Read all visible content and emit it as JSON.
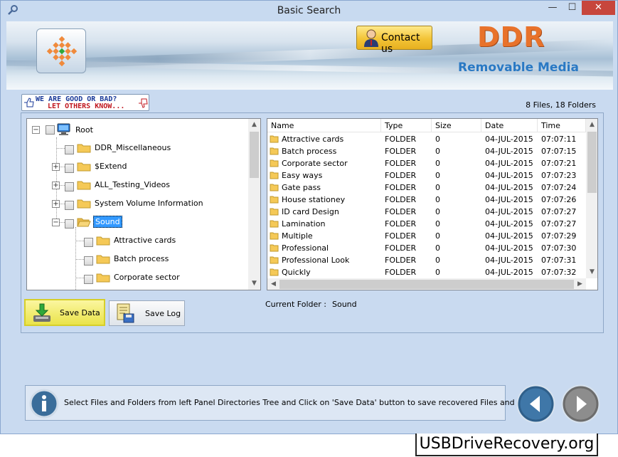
{
  "window": {
    "title": "Basic Search",
    "controls": {
      "minimize": "—",
      "maximize": "☐",
      "close": "✕"
    }
  },
  "banner": {
    "contact_label": "Contact us",
    "brand": "DDR",
    "brand_sub": "Removable Media"
  },
  "feedback": {
    "line1": "WE ARE GOOD OR BAD?",
    "line2": "LET OTHERS KNOW..."
  },
  "counts": "8 Files, 18 Folders",
  "tree": {
    "root": "Root",
    "items": [
      {
        "label": "DDR_Miscellaneous",
        "expander": "",
        "level": 1
      },
      {
        "label": "$Extend",
        "expander": "+",
        "level": 1
      },
      {
        "label": "ALL_Testing_Videos",
        "expander": "+",
        "level": 1
      },
      {
        "label": "System Volume Information",
        "expander": "+",
        "level": 1
      },
      {
        "label": "Sound",
        "expander": "−",
        "level": 1,
        "selected": true
      },
      {
        "label": "Attractive cards",
        "expander": "",
        "level": 2
      },
      {
        "label": "Batch process",
        "expander": "",
        "level": 2
      },
      {
        "label": "Corporate sector",
        "expander": "",
        "level": 2
      }
    ]
  },
  "list": {
    "columns": [
      "Name",
      "Type",
      "Size",
      "Date",
      "Time"
    ],
    "rows": [
      {
        "name": "Attractive cards",
        "type": "FOLDER",
        "size": "0",
        "date": "04-JUL-2015",
        "time": "07:07:11"
      },
      {
        "name": "Batch process",
        "type": "FOLDER",
        "size": "0",
        "date": "04-JUL-2015",
        "time": "07:07:15"
      },
      {
        "name": "Corporate sector",
        "type": "FOLDER",
        "size": "0",
        "date": "04-JUL-2015",
        "time": "07:07:21"
      },
      {
        "name": "Easy ways",
        "type": "FOLDER",
        "size": "0",
        "date": "04-JUL-2015",
        "time": "07:07:23"
      },
      {
        "name": "Gate pass",
        "type": "FOLDER",
        "size": "0",
        "date": "04-JUL-2015",
        "time": "07:07:24"
      },
      {
        "name": "House stationey",
        "type": "FOLDER",
        "size": "0",
        "date": "04-JUL-2015",
        "time": "07:07:26"
      },
      {
        "name": "ID card Design",
        "type": "FOLDER",
        "size": "0",
        "date": "04-JUL-2015",
        "time": "07:07:27"
      },
      {
        "name": "Lamination",
        "type": "FOLDER",
        "size": "0",
        "date": "04-JUL-2015",
        "time": "07:07:27"
      },
      {
        "name": "Multiple",
        "type": "FOLDER",
        "size": "0",
        "date": "04-JUL-2015",
        "time": "07:07:29"
      },
      {
        "name": "Professional",
        "type": "FOLDER",
        "size": "0",
        "date": "04-JUL-2015",
        "time": "07:07:30"
      },
      {
        "name": "Professional Look",
        "type": "FOLDER",
        "size": "0",
        "date": "04-JUL-2015",
        "time": "07:07:31"
      },
      {
        "name": "Quickly",
        "type": "FOLDER",
        "size": "0",
        "date": "04-JUL-2015",
        "time": "07:07:32"
      }
    ]
  },
  "buttons": {
    "save_data": "Save Data",
    "save_log": "Save Log"
  },
  "current_folder": {
    "label": "Current Folder :",
    "value": "Sound"
  },
  "status": "Select Files and Folders from left Panel Directories Tree and Click on 'Save Data' button to save recovered Files and Folders.",
  "watermark": "USBDriveRecovery.org",
  "icons": {
    "app": "magnifier-icon",
    "logo": "checker-logo-icon",
    "info": "info-icon",
    "back": "back-arrow-icon",
    "next": "next-arrow-icon"
  },
  "colors": {
    "accent": "#3399ff",
    "brand": "#e8722b",
    "brand_sub": "#2a79c4",
    "save_button": "#eae34a"
  }
}
